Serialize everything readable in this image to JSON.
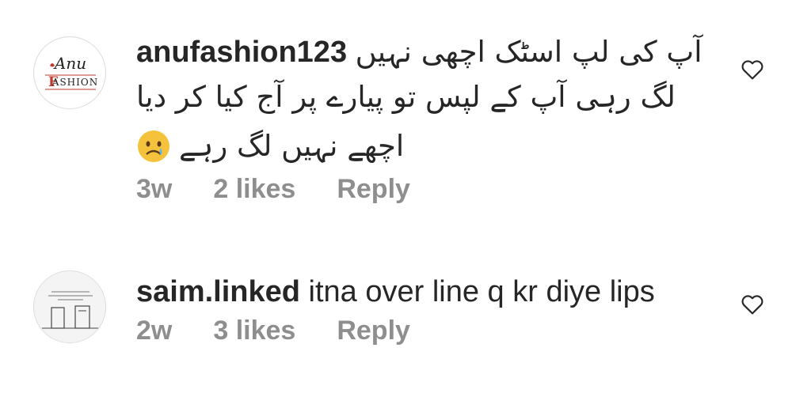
{
  "comments": [
    {
      "username": "anufashion123",
      "avatar_text_top": "Anu",
      "avatar_text_bottom": "ASHION",
      "text_line1": "آپ کی لپ اسٹک اچھی نہیں",
      "text_line2": "لگ رہی آپ کے لپس تو پیارے پر آج کیا کر دیا",
      "text_line3": "اچھے نہیں لگ رہے",
      "emoji": "crying-face",
      "time": "3w",
      "likes": "2 likes",
      "reply": "Reply",
      "icon": "heart-outline-icon"
    },
    {
      "username": "saim.linked",
      "text": "itna over line q kr diye lips",
      "time": "2w",
      "likes": "3 likes",
      "reply": "Reply",
      "icon": "heart-outline-icon"
    }
  ],
  "colors": {
    "text": "#262626",
    "meta": "#8e8e8e",
    "avatar_red": "#c0392b"
  }
}
